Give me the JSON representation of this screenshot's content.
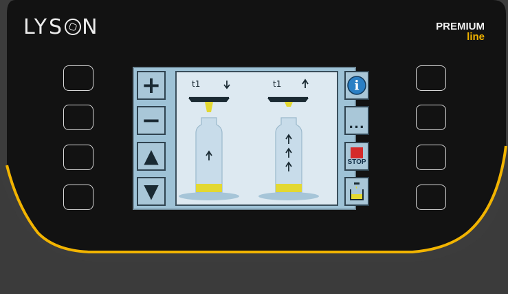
{
  "brand": {
    "logo_text_left": "LYS",
    "logo_text_right": "N",
    "badge_line1": "PREMIUM",
    "badge_line2": "line"
  },
  "colors": {
    "panel": "#121212",
    "accent_stripe": "#f2b400",
    "lower_body": "#3c3c3c",
    "screen_bg": "#9ec2d6",
    "honey": "#e3d832",
    "stop_red": "#d42a2a",
    "info_blue": "#2a7fc4"
  },
  "screen": {
    "left_toolbar": [
      {
        "name": "plus",
        "glyph": "+"
      },
      {
        "name": "minus",
        "glyph": "−"
      },
      {
        "name": "up",
        "glyph": "▲"
      },
      {
        "name": "down",
        "glyph": "▼"
      }
    ],
    "right_toolbar": {
      "info_glyph": "i",
      "more_glyph": "...",
      "stop_label": "STOP"
    },
    "stations": [
      {
        "time_label": "t1",
        "direction": "down"
      },
      {
        "time_label": "t1",
        "direction": "up"
      }
    ]
  },
  "hardware_buttons": {
    "left_count": 4,
    "right_count": 4
  }
}
